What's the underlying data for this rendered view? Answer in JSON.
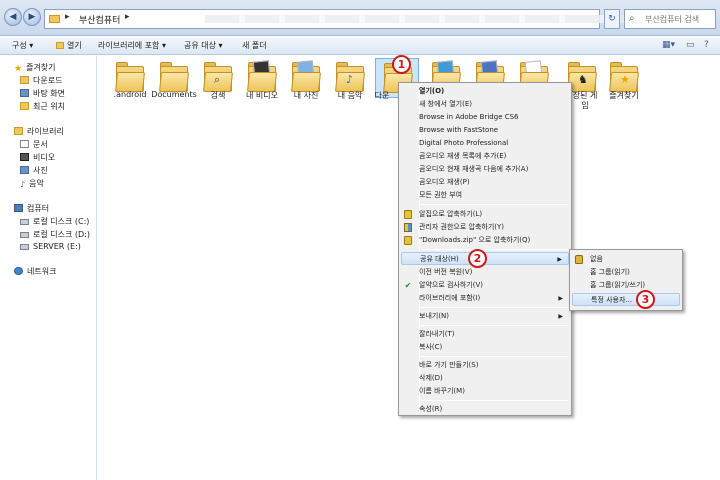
{
  "address_bar": {
    "back_icon": "back-arrow-icon",
    "forward_icon": "forward-arrow-icon",
    "path_root": "▸",
    "path_current": "부산컴퓨터",
    "path_arrow": "▸",
    "refresh_icon": "refresh-icon",
    "search_placeholder": "부산컴퓨터 검색",
    "search_icon": "magnifier-icon"
  },
  "toolbar": {
    "organize": "구성 ▾",
    "open": "열기",
    "include_library": "라이브러리에 포함 ▾",
    "share": "공유 대상 ▾",
    "new_folder": "새 폴더"
  },
  "nav": {
    "favorites": "즐겨찾기",
    "downloads": "다운로드",
    "desktop": "바탕 화면",
    "recent": "최근 위치",
    "libraries": "라이브러리",
    "documents": "문서",
    "videos": "비디오",
    "pictures": "사진",
    "music": "음악",
    "computer": "컴퓨터",
    "local_c": "로컬 디스크 (C:)",
    "local_d": "로컬 디스크 (D:)",
    "server_e": "SERVER (E:)",
    "network": "네트워크"
  },
  "folders": [
    {
      "label": ".android"
    },
    {
      "label": "Documents"
    },
    {
      "label": "검색"
    },
    {
      "label": "내 비디오"
    },
    {
      "label": "내 사진"
    },
    {
      "label": "내 음악"
    },
    {
      "label": "다운"
    },
    {
      "label": ""
    },
    {
      "label": ""
    },
    {
      "label": ""
    },
    {
      "label": "장된 게"
    },
    {
      "label": "즐겨찾기"
    }
  ],
  "folder_label_extra": "임",
  "context_menu": {
    "open": "열기(O)",
    "open_new_window": "새 창에서 열기(E)",
    "browse_bridge": "Browse in Adobe Bridge CS6",
    "browse_faststone": "Browse with FastStone",
    "digital_photo": "Digital Photo Professional",
    "audio_add_playlist": "곰오디오 재생 목록에 추가(E)",
    "audio_add_next": "곰오디오 현재 재생곡 다음에 추가(A)",
    "audio_play": "곰오디오 재생(P)",
    "grant_all": "모든 권한 부여",
    "alzip_compress": "알집으로 압축하기(L)",
    "admin_compress": "관리자 권한으로 압축하기(Y)",
    "zip_compress": "\"Downloads.zip\" 으로 압축하기(Q)",
    "share_with": "공유 대상(H)",
    "restore_versions": "이전 버전 복원(V)",
    "alyac_scan": "알약으로 검사하기(V)",
    "include_library": "라이브러리에 포함(I)",
    "send_to": "보내기(N)",
    "cut": "잘라내기(T)",
    "copy": "복사(C)",
    "create_shortcut": "바로 가기 만들기(S)",
    "delete": "삭제(D)",
    "rename": "이름 바꾸기(M)",
    "properties": "속성(R)"
  },
  "share_submenu": {
    "nobody": "없음",
    "homegroup_read": "홈 그룹(읽기)",
    "homegroup_readwrite": "홈 그룹(읽기/쓰기)",
    "specific_people": "특정 사용자..."
  },
  "callouts": {
    "one": "1",
    "two": "2",
    "three": "3"
  },
  "colors": {
    "callout": "#d01818",
    "highlight": "#cfe2f8"
  }
}
